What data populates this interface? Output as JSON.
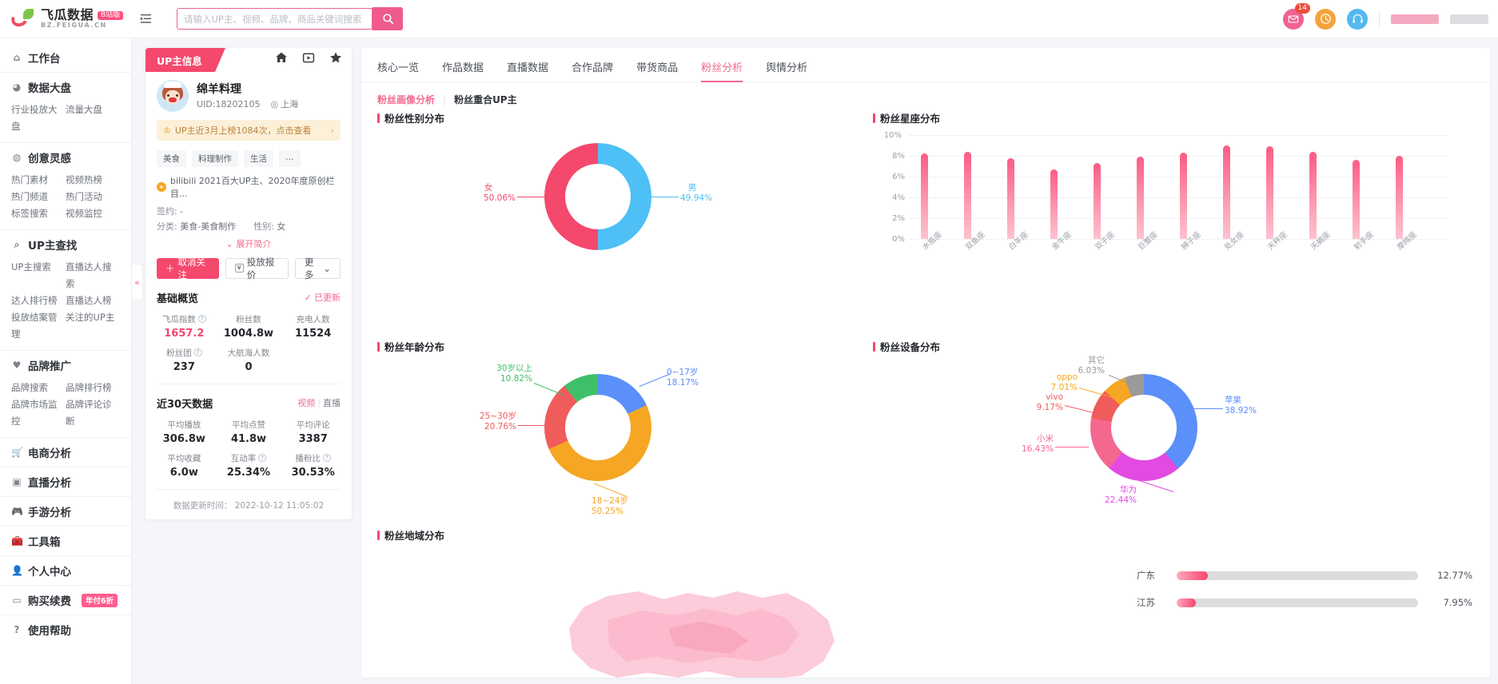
{
  "topbar": {
    "logo_name": "飞瓜数据",
    "logo_badge": "B站版",
    "logo_domain": "BZ.FEIGUA.CN",
    "search_placeholder": "请输入UP主、视频、品牌、商品关键词搜索",
    "search_value": "",
    "search_icon": "search-icon",
    "mail_badge": "14"
  },
  "sidebar": {
    "groups": [
      {
        "title": "工作台",
        "icon": "home-icon",
        "links": []
      },
      {
        "title": "数据大盘",
        "icon": "pie-icon",
        "links": [
          "行业投放大盘",
          "流量大盘"
        ]
      },
      {
        "title": "创意灵感",
        "icon": "bulb-icon",
        "links": [
          "热门素材",
          "视频热榜",
          "热门频道",
          "热门活动",
          "标签搜索",
          "视频监控"
        ]
      },
      {
        "title": "UP主查找",
        "icon": "search-icon",
        "links": [
          "UP主搜索",
          "直播达人搜索",
          "达人排行榜",
          "直播达人榜",
          "投放结案管理",
          "关注的UP主"
        ]
      },
      {
        "title": "品牌推广",
        "icon": "heart-icon",
        "links": [
          "品牌搜索",
          "品牌排行榜",
          "品牌市场监控",
          "品牌评论诊断"
        ]
      },
      {
        "title": "电商分析",
        "icon": "cart-icon",
        "links": []
      },
      {
        "title": "直播分析",
        "icon": "video-icon",
        "links": []
      },
      {
        "title": "手游分析",
        "icon": "game-icon",
        "links": []
      },
      {
        "title": "工具箱",
        "icon": "toolbox-icon",
        "links": []
      },
      {
        "title": "个人中心",
        "icon": "user-icon",
        "links": []
      },
      {
        "title": "购买续费",
        "icon": "card-icon",
        "badge": "年付6折",
        "links": []
      },
      {
        "title": "使用帮助",
        "icon": "help-icon",
        "links": []
      }
    ]
  },
  "profile": {
    "tag": "UP主信息",
    "icons": [
      "home-icon",
      "video-icon",
      "star-icon"
    ],
    "name": "绵羊料理",
    "uid": "UID:18202105",
    "location": "上海",
    "rank_banner": "UP主近3月上榜1084次，点击查看",
    "tags": [
      "美食",
      "料理制作",
      "生活",
      "…"
    ],
    "honor": "bilibili 2021百大UP主、2020年度原创栏目...",
    "contract_label": "签约:",
    "contract_value": "-",
    "category_label": "分类:",
    "category_value": "美食-美食制作",
    "gender_label": "性别:",
    "gender_value": "女",
    "expand": "展开简介",
    "btn_follow": "取消关注",
    "btn_quote": "投放报价",
    "btn_more": "更多",
    "overview_title": "基础概览",
    "overview_status": "已更新",
    "overview_metrics": [
      {
        "label": "飞瓜指数",
        "value": "1657.2",
        "help": true,
        "pink": true
      },
      {
        "label": "粉丝数",
        "value": "1004.8w",
        "help": false,
        "pink": false
      },
      {
        "label": "充电人数",
        "value": "11524",
        "help": false,
        "pink": false
      },
      {
        "label": "粉丝团",
        "value": "237",
        "help": true,
        "pink": false
      },
      {
        "label": "大航海人数",
        "value": "0",
        "help": false,
        "pink": false
      }
    ],
    "recent_title": "近30天数据",
    "recent_link_video": "视频",
    "recent_link_live": "直播",
    "recent_metrics": [
      {
        "label": "平均播放",
        "value": "306.8w",
        "help": false
      },
      {
        "label": "平均点赞",
        "value": "41.8w",
        "help": false
      },
      {
        "label": "平均评论",
        "value": "3387",
        "help": false
      },
      {
        "label": "平均收藏",
        "value": "6.0w",
        "help": false
      },
      {
        "label": "互动率",
        "value": "25.34%",
        "help": true
      },
      {
        "label": "播粉比",
        "value": "30.53%",
        "help": true
      }
    ],
    "updated_label": "数据更新时间：",
    "updated_value": "2022-10-12 11:05:02"
  },
  "main": {
    "tabs": [
      {
        "label": "核心一览",
        "active": false
      },
      {
        "label": "作品数据",
        "active": false
      },
      {
        "label": "直播数据",
        "active": false
      },
      {
        "label": "合作品牌",
        "active": false
      },
      {
        "label": "带货商品",
        "active": false
      },
      {
        "label": "粉丝分析",
        "active": true
      },
      {
        "label": "舆情分析",
        "active": false
      }
    ],
    "subtabs": [
      {
        "label": "粉丝画像分析",
        "active": true
      },
      {
        "label": "粉丝重合UP主",
        "active": false
      }
    ],
    "sections": {
      "gender": "粉丝性别分布",
      "zodiac": "粉丝星座分布",
      "age": "粉丝年龄分布",
      "device": "粉丝设备分布",
      "region": "粉丝地域分布"
    }
  },
  "chart_data": [
    {
      "type": "pie",
      "title": "粉丝性别分布",
      "labels": [
        "女",
        "男"
      ],
      "values": [
        50.06,
        49.94
      ],
      "value_labels": [
        "50.06%",
        "49.94%"
      ],
      "colors": [
        "#f4486d",
        "#4ec0f5"
      ]
    },
    {
      "type": "bar",
      "title": "粉丝星座分布",
      "categories": [
        "水瓶座",
        "双鱼座",
        "白羊座",
        "金牛座",
        "双子座",
        "巨蟹座",
        "狮子座",
        "处女座",
        "天秤座",
        "天蝎座",
        "射手座",
        "摩羯座"
      ],
      "values": [
        8.2,
        8.4,
        7.8,
        6.7,
        7.3,
        7.9,
        8.3,
        9.0,
        8.9,
        8.4,
        7.6,
        8.0
      ],
      "ylabel": "",
      "xlabel": "",
      "ylim": [
        0,
        10
      ],
      "yticks": [
        0,
        2,
        4,
        6,
        8,
        10
      ],
      "ytick_labels": [
        "0%",
        "2%",
        "4%",
        "6%",
        "8%",
        "10%"
      ],
      "grid": true,
      "bar_color": "#fb5c84"
    },
    {
      "type": "pie",
      "title": "粉丝年龄分布",
      "labels": [
        "0~17岁",
        "18~24岁",
        "25~30岁",
        "30岁以上"
      ],
      "values": [
        18.17,
        50.25,
        20.76,
        10.82
      ],
      "value_labels": [
        "18.17%",
        "50.25%",
        "20.76%",
        "10.82%"
      ],
      "colors": [
        "#5b8ff9",
        "#f5a623",
        "#f05b5b",
        "#3ec06a"
      ]
    },
    {
      "type": "pie",
      "title": "粉丝设备分布",
      "labels": [
        "苹果",
        "华为",
        "小米",
        "vivo",
        "oppo",
        "其它"
      ],
      "values": [
        38.92,
        22.44,
        16.43,
        9.17,
        7.01,
        6.03
      ],
      "value_labels": [
        "38.92%",
        "22.44%",
        "16.43%",
        "9.17%",
        "7.01%",
        "6.03%"
      ],
      "colors": [
        "#5b8ff9",
        "#e24ae2",
        "#f4688f",
        "#f05b5b",
        "#f5a623",
        "#9a9a9a"
      ]
    },
    {
      "type": "bar",
      "title": "粉丝地域分布",
      "orientation": "horizontal",
      "categories": [
        "广东",
        "江苏"
      ],
      "values": [
        12.77,
        7.95
      ],
      "value_labels": [
        "12.77%",
        "7.95%"
      ],
      "max": 100,
      "bar_color": "#f9446f"
    }
  ]
}
